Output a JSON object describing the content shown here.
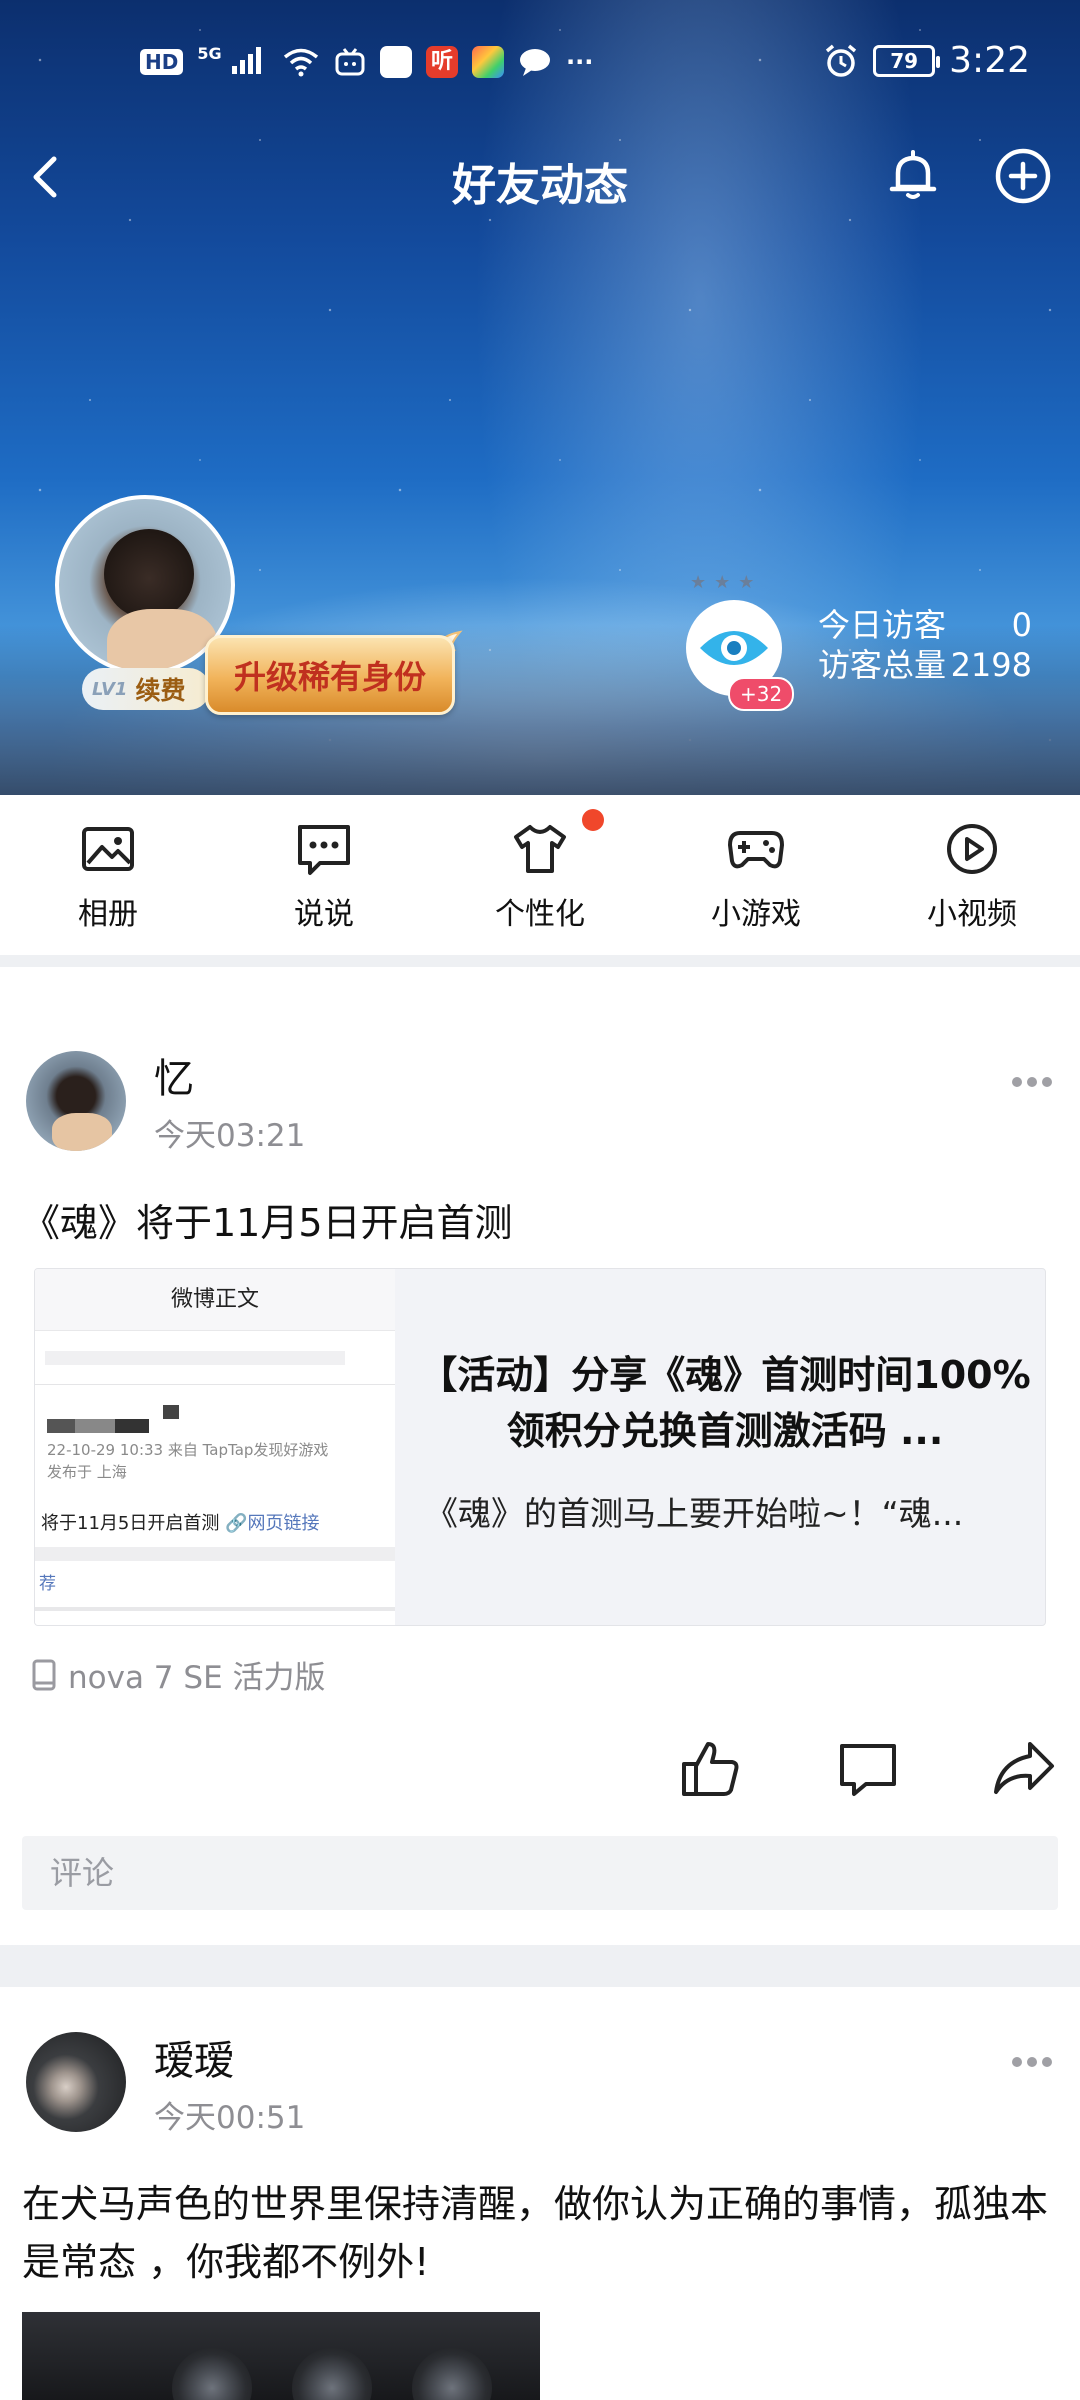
{
  "status_bar": {
    "network": "HD",
    "signal": "5G",
    "apps": [
      "bilibili-icon",
      "mail-icon",
      "ting-icon",
      "brush-icon",
      "chat-icon"
    ],
    "ting_label": "听",
    "more": "···",
    "battery": "79",
    "time": "3:22"
  },
  "nav": {
    "title": "好友动态"
  },
  "profile": {
    "level": "LV1",
    "renew_label": "续费",
    "upgrade_label": "升级稀有身份",
    "visitor_badge": "+32",
    "today_label": "今日访客",
    "today_value": "0",
    "total_label": "访客总量",
    "total_value": "2198"
  },
  "shortcuts": [
    {
      "label": "相册",
      "icon": "image-icon"
    },
    {
      "label": "说说",
      "icon": "chat-bubble-icon"
    },
    {
      "label": "个性化",
      "icon": "tshirt-icon",
      "dot": true
    },
    {
      "label": "小游戏",
      "icon": "gamepad-icon"
    },
    {
      "label": "小视频",
      "icon": "play-circle-icon"
    }
  ],
  "post1": {
    "author": "忆",
    "time": "今天03:21",
    "text": "《魂》将于11月5日开启首测",
    "card": {
      "thumb_header": "微博正文",
      "thumb_meta_line1": "22-10-29 10:33  来自 TapTap发现好游戏",
      "thumb_meta_line2": "发布于 上海",
      "thumb_text": "将于11月5日开启首测",
      "thumb_link": "🔗网页链接",
      "thumb_rec": "荐",
      "title": "【活动】分享《魂》首测时间100%领积分兑换首测激活码 ...",
      "desc": "《魂》的首测马上要开始啦~！“魂..."
    },
    "device": "nova 7 SE  活力版",
    "comment_placeholder": "评论"
  },
  "post2": {
    "author": "瑷瑷",
    "time": "今天00:51",
    "text": "在犬马声色的世界里保持清醒，做你认为正确的事情，孤独本是常态 ，你我都不例外!"
  }
}
